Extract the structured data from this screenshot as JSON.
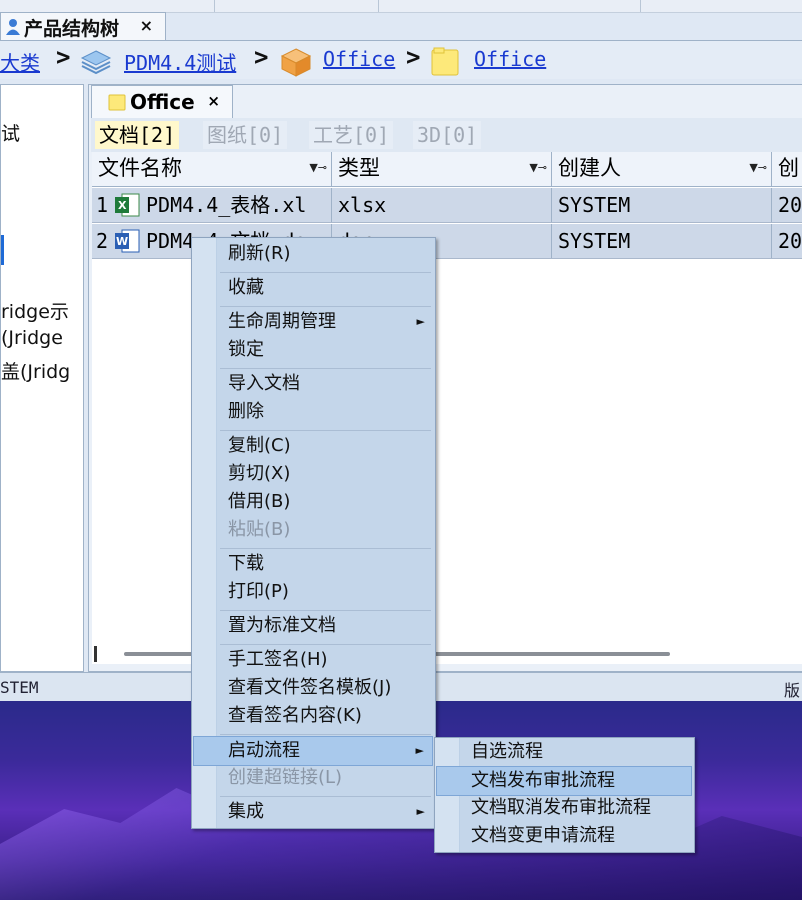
{
  "top_tab": {
    "label": "产品结构树",
    "close": "×"
  },
  "breadcrumb": {
    "items": [
      "大类",
      "PDM4.4测试",
      "Office",
      "Office"
    ],
    "separator": ">"
  },
  "left_tree": {
    "items": [
      "试",
      "ridge示",
      "(Jridge",
      "盖(Jridg"
    ]
  },
  "office_tab": {
    "label": "Office",
    "close": "×"
  },
  "sub_tabs": [
    "文档[2]",
    "图纸[0]",
    "工艺[0]",
    "3D[0]"
  ],
  "columns": [
    "文件名称",
    "类型",
    "创建人",
    "创"
  ],
  "rows": [
    {
      "num": "1",
      "name": "PDM4.4_表格.xl",
      "type": "xlsx",
      "creator": "SYSTEM",
      "created": "20",
      "icon": "excel-icon"
    },
    {
      "num": "2",
      "name": "PDM4 4 文档 do",
      "type": "docx",
      "creator": "SYSTEM",
      "created": "20",
      "icon": "word-icon"
    }
  ],
  "status": {
    "left": "STEM",
    "right": "版"
  },
  "context_menu": {
    "items": [
      {
        "label": "刷新(R)"
      },
      {
        "label": "收藏"
      },
      {
        "label": "生命周期管理",
        "submenu": true
      },
      {
        "label": "锁定"
      },
      {
        "label": "导入文档"
      },
      {
        "label": "删除"
      },
      {
        "label": "复制(C)"
      },
      {
        "label": "剪切(X)"
      },
      {
        "label": "借用(B)"
      },
      {
        "label": "粘贴(B)",
        "disabled": true
      },
      {
        "label": "下载"
      },
      {
        "label": "打印(P)"
      },
      {
        "label": "置为标准文档"
      },
      {
        "label": "手工签名(H)"
      },
      {
        "label": "查看文件签名模板(J)"
      },
      {
        "label": "查看签名内容(K)"
      },
      {
        "label": "启动流程",
        "submenu": true,
        "highlighted": true
      },
      {
        "label": "创建超链接(L)",
        "disabled": true
      },
      {
        "label": "集成",
        "submenu": true
      }
    ]
  },
  "flow_submenu": {
    "items": [
      {
        "label": "自选流程"
      },
      {
        "label": "文档发布审批流程",
        "highlighted": true
      },
      {
        "label": "文档取消发布审批流程"
      },
      {
        "label": "文档变更申请流程"
      }
    ]
  },
  "colors": {
    "link": "#1a3ad0",
    "menu_bg": "#c4d6ea",
    "menu_highlight": "#a9c9ec",
    "active_subtab": "#fff8cc"
  }
}
